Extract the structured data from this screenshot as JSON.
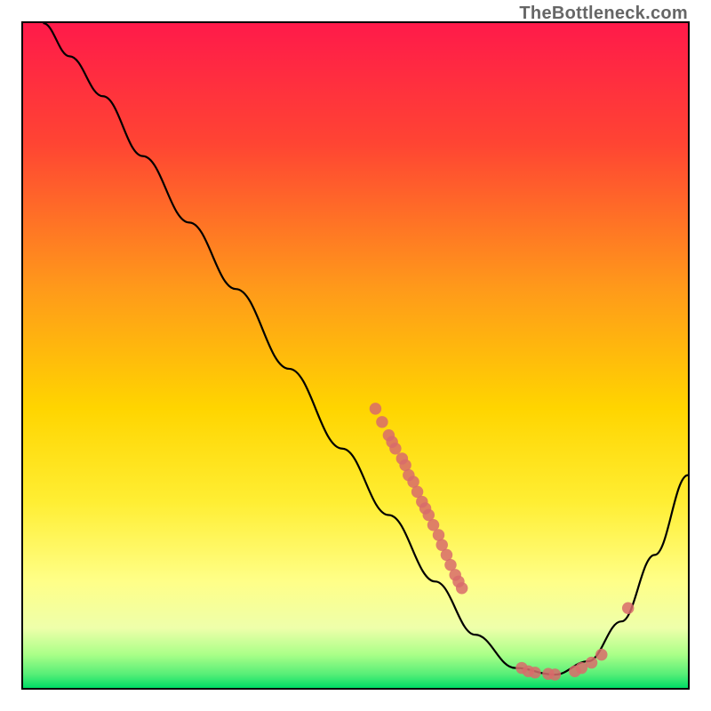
{
  "watermark": "TheBottleneck.com",
  "chart_data": {
    "type": "line",
    "title": "",
    "xlabel": "",
    "ylabel": "",
    "xlim": [
      0,
      100
    ],
    "ylim": [
      0,
      100
    ],
    "gradient_background": {
      "top_color": "#ff1a4a",
      "mid_upper": "#ff7a1a",
      "mid_color": "#ffe600",
      "mid_lower": "#ffff66",
      "bottom_near": "#ccff66",
      "bottom_color": "#00e666"
    },
    "series": [
      {
        "name": "curve",
        "type": "path",
        "stroke": "#000000",
        "points": [
          {
            "x": 3,
            "y": 100
          },
          {
            "x": 7,
            "y": 95
          },
          {
            "x": 12,
            "y": 89
          },
          {
            "x": 18,
            "y": 80
          },
          {
            "x": 25,
            "y": 70
          },
          {
            "x": 32,
            "y": 60
          },
          {
            "x": 40,
            "y": 48
          },
          {
            "x": 48,
            "y": 36
          },
          {
            "x": 55,
            "y": 26
          },
          {
            "x": 62,
            "y": 16
          },
          {
            "x": 68,
            "y": 8
          },
          {
            "x": 74,
            "y": 3
          },
          {
            "x": 80,
            "y": 2
          },
          {
            "x": 85,
            "y": 4
          },
          {
            "x": 90,
            "y": 10
          },
          {
            "x": 95,
            "y": 20
          },
          {
            "x": 100,
            "y": 32
          }
        ]
      },
      {
        "name": "cluster_points_upper",
        "type": "scatter",
        "points": [
          {
            "x": 53,
            "y": 42
          },
          {
            "x": 54,
            "y": 40
          },
          {
            "x": 55,
            "y": 38
          },
          {
            "x": 55.5,
            "y": 37
          },
          {
            "x": 56,
            "y": 36
          },
          {
            "x": 57,
            "y": 34.5
          },
          {
            "x": 57.5,
            "y": 33.5
          },
          {
            "x": 58,
            "y": 32
          },
          {
            "x": 58.7,
            "y": 31
          },
          {
            "x": 59.3,
            "y": 29.5
          },
          {
            "x": 60,
            "y": 28
          },
          {
            "x": 60.5,
            "y": 27
          },
          {
            "x": 61,
            "y": 26
          },
          {
            "x": 61.7,
            "y": 24.5
          },
          {
            "x": 62.5,
            "y": 23
          },
          {
            "x": 63,
            "y": 21.5
          },
          {
            "x": 63.7,
            "y": 20
          },
          {
            "x": 64.3,
            "y": 18.5
          },
          {
            "x": 65,
            "y": 17
          },
          {
            "x": 65.5,
            "y": 16
          },
          {
            "x": 66,
            "y": 15
          }
        ]
      },
      {
        "name": "cluster_points_bottom",
        "type": "scatter",
        "points": [
          {
            "x": 75,
            "y": 3
          },
          {
            "x": 76,
            "y": 2.5
          },
          {
            "x": 77,
            "y": 2.3
          },
          {
            "x": 79,
            "y": 2.1
          },
          {
            "x": 80,
            "y": 2
          },
          {
            "x": 83,
            "y": 2.5
          },
          {
            "x": 84,
            "y": 3
          },
          {
            "x": 85.5,
            "y": 3.8
          },
          {
            "x": 87,
            "y": 5
          }
        ]
      },
      {
        "name": "single_point_right",
        "type": "scatter",
        "points": [
          {
            "x": 91,
            "y": 12
          }
        ]
      }
    ]
  }
}
